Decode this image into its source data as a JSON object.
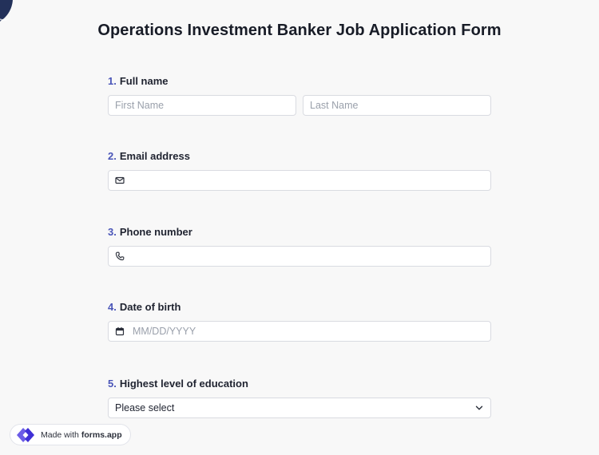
{
  "page": {
    "title": "Operations Investment Banker Job Application Form"
  },
  "questions": [
    {
      "num": "1.",
      "label": "Full name",
      "first_placeholder": "First Name",
      "last_placeholder": "Last Name"
    },
    {
      "num": "2.",
      "label": "Email address",
      "icon": "envelope-icon",
      "value": ""
    },
    {
      "num": "3.",
      "label": "Phone number",
      "icon": "phone-icon",
      "value": ""
    },
    {
      "num": "4.",
      "label": "Date of birth",
      "icon": "calendar-icon",
      "placeholder": "MM/DD/YYYY"
    },
    {
      "num": "5.",
      "label": "Highest level of education",
      "selected": "Please select",
      "icon": "chevron-down-icon"
    }
  ],
  "badge": {
    "prefix": "Made with",
    "brand": "forms.app"
  },
  "colors": {
    "accent": "#4a55b8",
    "brand_icon": "#6b5ce7",
    "logo": "#23315a"
  }
}
